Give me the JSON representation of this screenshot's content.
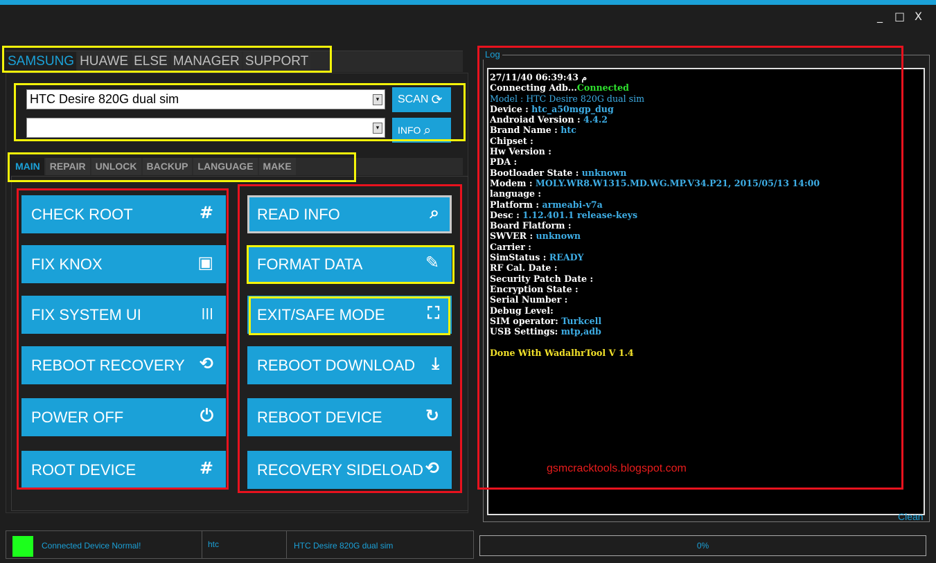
{
  "window": {
    "minimize": "_",
    "maximize": "□",
    "close": "X",
    "accent": "#1ba1d8"
  },
  "top_tabs": [
    "SAMSUNG",
    "HUAWE",
    "ELSE",
    "MANAGER",
    "SUPPORT"
  ],
  "device_select": {
    "value": "HTC Desire 820G dual sim",
    "dropdown_arrow": "▾"
  },
  "second_select": {
    "value": "",
    "dropdown_arrow": "▾"
  },
  "scan_button": {
    "label": "SCAN",
    "icon": "refresh-icon"
  },
  "info_button": {
    "label": "INFO",
    "icon": "search-icon"
  },
  "sub_tabs": [
    "MAIN",
    "REPAIR",
    "UNLOCK",
    "BACKUP",
    "LANGUAGE",
    "MAKE"
  ],
  "left_buttons": [
    {
      "label": "CHECK ROOT",
      "icon": "#"
    },
    {
      "label": "FIX KNOX",
      "icon": "▣"
    },
    {
      "label": "FIX SYSTEM UI",
      "icon": "|||"
    },
    {
      "label": "REBOOT RECOVERY",
      "icon": "⟲"
    },
    {
      "label": "POWER OFF",
      "icon": "⏻"
    },
    {
      "label": "ROOT DEVICE",
      "icon": "#"
    }
  ],
  "right_buttons": [
    {
      "label": "READ INFO",
      "icon": "⌕"
    },
    {
      "label": "FORMAT DATA",
      "icon": "✎"
    },
    {
      "label": "EXIT/SAFE MODE",
      "icon": "⛶"
    },
    {
      "label": "REBOOT DOWNLOAD",
      "icon": "⤓"
    },
    {
      "label": "REBOOT  DEVICE",
      "icon": "↻"
    },
    {
      "label": "RECOVERY SIDELOAD",
      "icon": "⟲"
    }
  ],
  "log": {
    "legend": "Log",
    "timestamp": "27/11/40 06:39:43 م",
    "connecting": {
      "k": "Connecting Adb...",
      "v": "Connected"
    },
    "model": {
      "k": "Model : ",
      "v": "HTC Desire 820G dual sim"
    },
    "device": {
      "k": "Device : ",
      "v": "htc_a50mgp_dug"
    },
    "android": {
      "k": "Androiad Version : ",
      "v": "4.4.2"
    },
    "brand": {
      "k": "Brand Name : ",
      "v": "htc"
    },
    "chipset": {
      "k": "Chipset :",
      "v": ""
    },
    "hw": {
      "k": "Hw Version :",
      "v": ""
    },
    "pda": {
      "k": "PDA :",
      "v": ""
    },
    "bootloader": {
      "k": "Bootloader State : ",
      "v": "unknown"
    },
    "modem": {
      "k": "Modem : ",
      "v": "MOLY.WR8.W1315.MD.WG.MP.V34.P21, 2015/05/13 14:00"
    },
    "language": {
      "k": "language :",
      "v": ""
    },
    "platform": {
      "k": "Platform : ",
      "v": "armeabi-v7a"
    },
    "desc": {
      "k": "Desc : ",
      "v": "1.12.401.1 release-keys"
    },
    "board": {
      "k": "Board Flatform :",
      "v": ""
    },
    "swver": {
      "k": "SWVER : ",
      "v": "unknown"
    },
    "carrier": {
      "k": "Carrier :",
      "v": ""
    },
    "sim": {
      "k": "SimStatus : ",
      "v": "READY"
    },
    "rfcal": {
      "k": "RF Cal. Date :",
      "v": ""
    },
    "patch": {
      "k": "Security Patch Date :",
      "v": ""
    },
    "encrypt": {
      "k": "Encryption State :",
      "v": ""
    },
    "serial": {
      "k": "Serial Number :",
      "v": ""
    },
    "debug": {
      "k": "Debug Level:",
      "v": ""
    },
    "operator": {
      "k": "SIM operator: ",
      "v": "Turkcell"
    },
    "usb": {
      "k": "USB Settings: ",
      "v": "mtp,adb"
    },
    "done": "Done With WadalhrTool V 1.4"
  },
  "watermark": "gsmcracktools.blogspot.com",
  "clean_label": "Clean",
  "status": {
    "message": "Connected Device Normal!",
    "brand": "htc",
    "model": "HTC Desire 820G dual sim",
    "indicator_color": "#1cff1c"
  },
  "progress": {
    "text": "0%",
    "value": 0
  }
}
